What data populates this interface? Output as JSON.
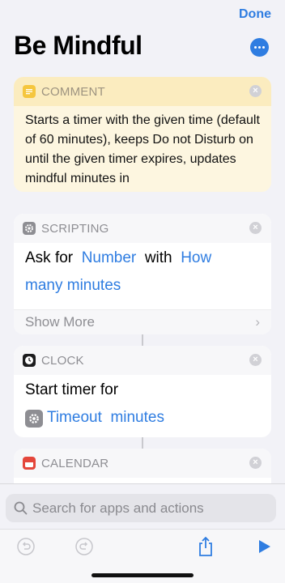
{
  "header": {
    "done_label": "Done",
    "title": "Be Mindful",
    "more_icon": "ellipsis-circle-icon"
  },
  "actions": {
    "comment": {
      "category": "COMMENT",
      "icon": "comment-icon",
      "text": "Starts a timer with the given time (default of 60 minutes), keeps Do not Disturb on until the given timer expires, updates mindful minutes in"
    },
    "scripting": {
      "category": "SCRIPTING",
      "icon": "gear-icon",
      "prefix": "Ask for",
      "token_type": "Number",
      "middle": "with",
      "token_prompt_line1": "How",
      "token_prompt_line2": "many minutes",
      "show_more": "Show More"
    },
    "clock": {
      "category": "CLOCK",
      "icon": "clock-icon",
      "prefix": "Start timer for",
      "token_variable": "Timeout",
      "token_unit": "minutes"
    },
    "calendar": {
      "category": "CALENDAR",
      "icon": "calendar-icon"
    }
  },
  "search": {
    "placeholder": "Search for apps and actions"
  },
  "toolbar": {
    "undo_icon": "undo-icon",
    "redo_icon": "redo-icon",
    "share_icon": "share-icon",
    "play_icon": "play-icon"
  },
  "colors": {
    "accent": "#2f7de1",
    "comment_bg": "#fdf6e0",
    "calendar_red": "#e4463b"
  }
}
